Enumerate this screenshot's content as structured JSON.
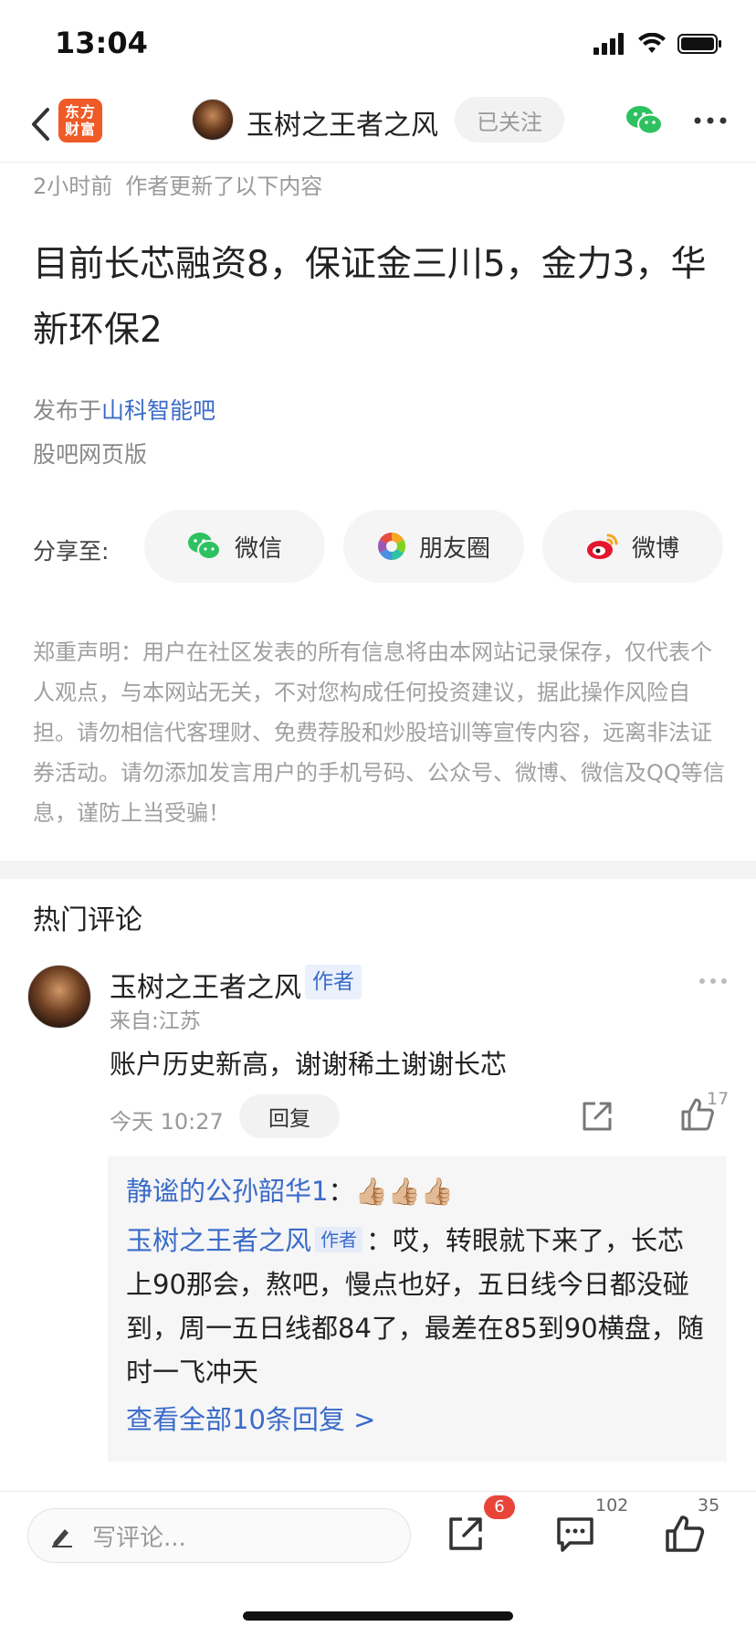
{
  "status_bar": {
    "time": "13:04"
  },
  "nav": {
    "logo_text": "东方财富",
    "author_name": "玉树之王者之风",
    "follow_label": "已关注"
  },
  "post": {
    "time_ago": "2小时前",
    "update_note": "作者更新了以下内容",
    "title": "目前长芯融资8，保证金三川5，金力3，华新环保2",
    "publish_prefix": "发布于",
    "forum_name": "山科智能吧",
    "source": "股吧网页版"
  },
  "share": {
    "label": "分享至:",
    "wechat": "微信",
    "moments": "朋友圈",
    "weibo": "微博"
  },
  "disclaimer": "郑重声明：用户在社区发表的所有信息将由本网站记录保存，仅代表个人观点，与本网站无关，不对您构成任何投资建议，据此操作风险自担。请勿相信代客理财、免费荐股和炒股培训等宣传内容，远离非法证券活动。请勿添加发言用户的手机号码、公众号、微博、微信及QQ等信息，谨防上当受骗！",
  "comments": {
    "section_title": "热门评论",
    "items": [
      {
        "user": "玉树之王者之风",
        "author_tag": "作者",
        "location": "来自:江苏",
        "text": "账户历史新高，谢谢稀土谢谢长芯",
        "time": "今天 10:27",
        "reply_label": "回复",
        "like_count": "17",
        "replies": [
          {
            "user": "静谧的公孙韶华1",
            "sep": "：",
            "text": "👍🏼👍🏼👍🏼"
          },
          {
            "user": "玉树之王者之风",
            "tag": "作者",
            "sep": "：",
            "text": "哎，转眼就下来了，长芯上90那会，熬吧，慢点也好，五日线今日都没碰到，周一五日线都84了，最差在85到90横盘，随时一飞冲天"
          }
        ],
        "view_all": "查看全部10条回复 >"
      }
    ]
  },
  "bottom_bar": {
    "input_placeholder": "写评论...",
    "share_badge": "6",
    "comment_count": "102",
    "like_count": "35"
  },
  "colors": {
    "accent_blue": "#3a6bc9",
    "logo_orange": "#ef5a26",
    "badge_red": "#e8443a"
  }
}
